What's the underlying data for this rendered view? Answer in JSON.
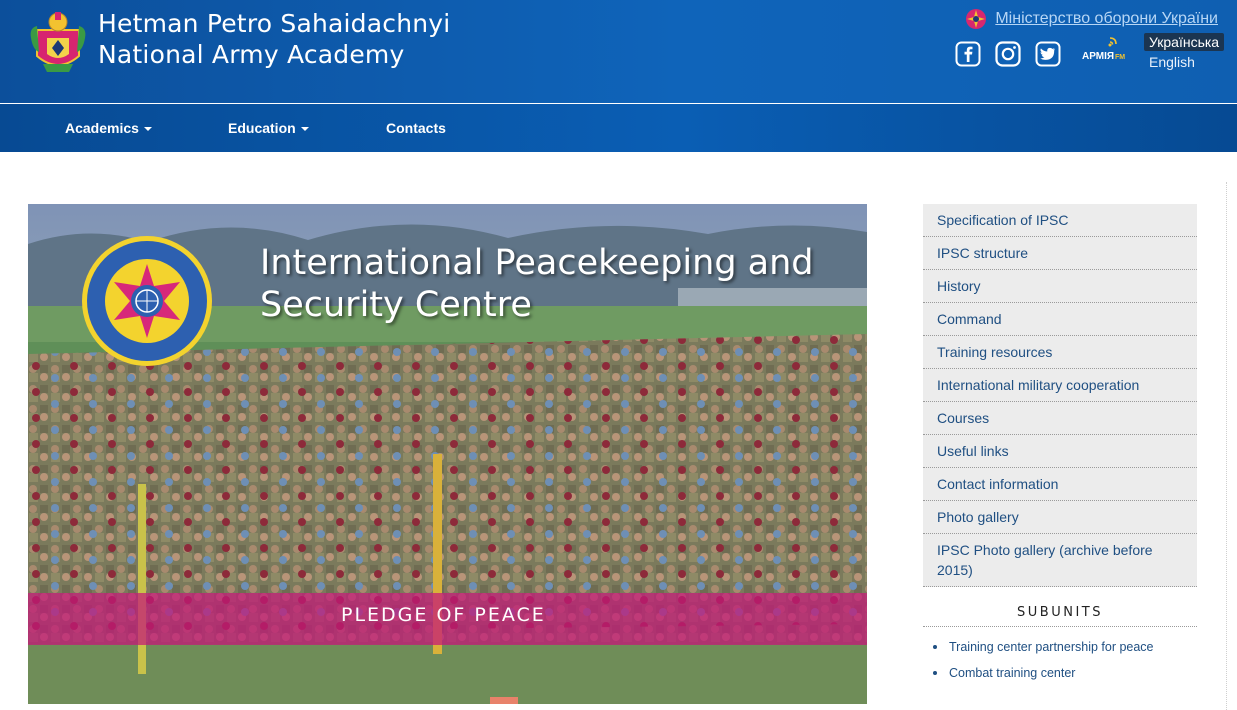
{
  "header": {
    "title_line1": "Hetman Petro Sahaidachnyi",
    "title_line2": "National Army Academy",
    "ministry_link": "Міністерство оборони України",
    "social": [
      "facebook-icon",
      "instagram-icon",
      "twitter-icon"
    ],
    "radio_logo": "АРМІЯ FM",
    "lang_active": "Українська",
    "lang_other": "English"
  },
  "nav": {
    "items": [
      "Academics",
      "Education",
      "Contacts"
    ]
  },
  "banner": {
    "title_line1": "International Peacekeeping and",
    "title_line2": "Security Centre",
    "caption": "PLEDGE OF PEACE",
    "emblem_text": "ЦЕНТР МИРОТВОРЧОСТІ ТА БЕЗПЕКИ МІЖНАРОДНИЙ"
  },
  "sidebar": {
    "menu": [
      "Specification of IPSC",
      "IPSC structure",
      "History",
      "Command",
      "Training resources",
      "International military cooperation",
      "Courses",
      "Useful links",
      "Contact information",
      "Photo gallery",
      "IPSC Photo gallery (archive before 2015)"
    ],
    "subunits_title": "SUBUNITS",
    "subunits": [
      "Training center partnership for peace",
      "Combat training center"
    ]
  },
  "colors": {
    "header_blue": "#0f64ba",
    "nav_blue": "#0a5eb4",
    "banner_strip": "#c41878",
    "link": "#1f4f82",
    "sidebar_bg": "#ececec"
  }
}
